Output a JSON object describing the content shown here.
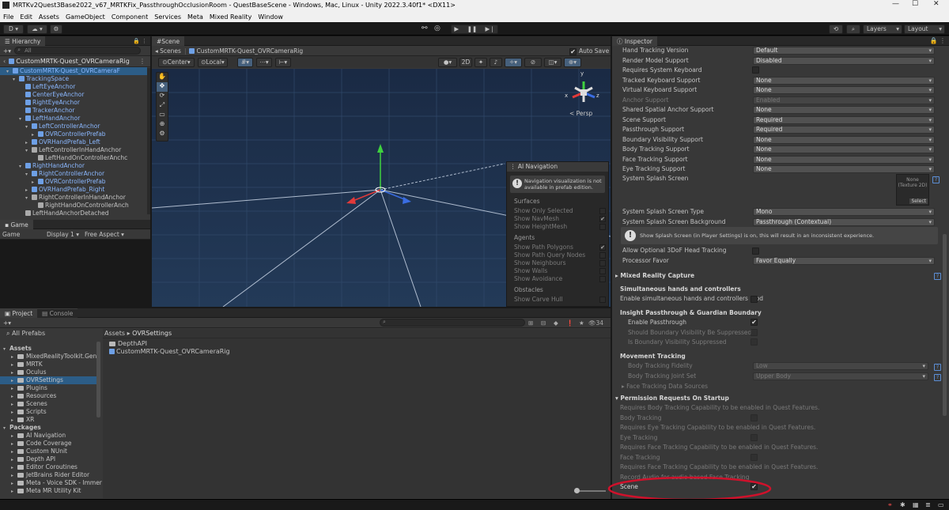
{
  "window": {
    "title": "MRTKv2Quest3Base2022_v67_MRTKFix_PassthroughOcclusionRoom - QuestBaseScene - Windows, Mac, Linux - Unity 2022.3.40f1* <DX11>",
    "minimize": "—",
    "maximize": "☐",
    "close": "✕"
  },
  "menu": [
    "File",
    "Edit",
    "Assets",
    "GameObject",
    "Component",
    "Services",
    "Meta",
    "Mixed Reality",
    "Window"
  ],
  "toolbar": {
    "account": "D",
    "layers": "Layers",
    "layout": "Layout"
  },
  "hierarchy": {
    "tab": "Hierarchy",
    "search_placeholder": "All",
    "root": "CustomMRTK-Quest_OVRCameraRig",
    "items": [
      {
        "label": "CustomMRTK-Quest_OVRCameraF",
        "indent": 1,
        "icon": "cube",
        "arrow": "▾",
        "selected": true
      },
      {
        "label": "TrackingSpace",
        "indent": 2,
        "icon": "cube",
        "arrow": "▾"
      },
      {
        "label": "LeftEyeAnchor",
        "indent": 3,
        "icon": "cube",
        "arrow": ""
      },
      {
        "label": "CenterEyeAnchor",
        "indent": 3,
        "icon": "cube",
        "arrow": ""
      },
      {
        "label": "RightEyeAnchor",
        "indent": 3,
        "icon": "cube",
        "arrow": ""
      },
      {
        "label": "TrackerAnchor",
        "indent": 3,
        "icon": "cube",
        "arrow": ""
      },
      {
        "label": "LeftHandAnchor",
        "indent": 3,
        "icon": "cube",
        "arrow": "▾"
      },
      {
        "label": "LeftControllerAnchor",
        "indent": 4,
        "icon": "cube",
        "arrow": "▾"
      },
      {
        "label": "OVRControllerPrefab",
        "indent": 5,
        "icon": "prefab",
        "arrow": "▸"
      },
      {
        "label": "OVRHandPrefab_Left",
        "indent": 4,
        "icon": "prefab",
        "arrow": "▸"
      },
      {
        "label": "LeftControllerInHandAnchor",
        "indent": 4,
        "icon": "cube",
        "arrow": "▾",
        "plain": true
      },
      {
        "label": "LeftHandOnControllerAnchc",
        "indent": 5,
        "icon": "cube",
        "arrow": "",
        "plain": true
      },
      {
        "label": "RightHandAnchor",
        "indent": 3,
        "icon": "cube",
        "arrow": "▾"
      },
      {
        "label": "RightControllerAnchor",
        "indent": 4,
        "icon": "cube",
        "arrow": "▾"
      },
      {
        "label": "OVRControllerPrefab",
        "indent": 5,
        "icon": "prefab",
        "arrow": "▸"
      },
      {
        "label": "OVRHandPrefab_Right",
        "indent": 4,
        "icon": "prefab",
        "arrow": "▸"
      },
      {
        "label": "RightControllerInHandAnchor",
        "indent": 4,
        "icon": "cube",
        "arrow": "▾",
        "plain": true
      },
      {
        "label": "RightHandOnControllerAnch",
        "indent": 5,
        "icon": "cube",
        "arrow": "",
        "plain": true
      },
      {
        "label": "LeftHandAnchorDetached",
        "indent": 3,
        "icon": "cube",
        "arrow": "",
        "plain": true
      }
    ]
  },
  "game": {
    "tab": "Game",
    "display": "Game",
    "display_num": "Display 1",
    "aspect": "Free Aspect"
  },
  "scene": {
    "tab": "Scene",
    "breadcrumb_root": "Scenes",
    "breadcrumb_item": "CustomMRTK-Quest_OVRCameraRig",
    "auto_save": "Auto Save",
    "pivot": "Center",
    "space": "Local",
    "mode_2d": "2D",
    "persp": "< Persp",
    "gizmo_x": "x",
    "gizmo_y": "y",
    "gizmo_z": "z"
  },
  "ai_nav": {
    "title": "AI Navigation",
    "notice": "Navigation visualization is not available in prefab edition.",
    "sections": [
      {
        "header": "Surfaces",
        "items": [
          {
            "label": "Show Only Selected",
            "checked": false
          },
          {
            "label": "Show NavMesh",
            "checked": true
          },
          {
            "label": "Show HeightMesh",
            "checked": false
          }
        ]
      },
      {
        "header": "Agents",
        "items": [
          {
            "label": "Show Path Polygons",
            "checked": true
          },
          {
            "label": "Show Path Query Nodes",
            "checked": false
          },
          {
            "label": "Show Neighbours",
            "checked": false
          },
          {
            "label": "Show Walls",
            "checked": false
          },
          {
            "label": "Show Avoidance",
            "checked": false
          }
        ]
      },
      {
        "header": "Obstacles",
        "items": [
          {
            "label": "Show Carve Hull",
            "checked": false
          }
        ]
      }
    ]
  },
  "project": {
    "tab_project": "Project",
    "tab_console": "Console",
    "all_prefabs": "All Prefabs",
    "hidden_count": "34",
    "breadcrumb": [
      "Assets",
      "OVRSettings"
    ],
    "tree": [
      {
        "label": "Assets",
        "indent": 0,
        "bold": true
      },
      {
        "label": "MixedRealityToolkit.Gene",
        "indent": 1
      },
      {
        "label": "MRTK",
        "indent": 1
      },
      {
        "label": "Oculus",
        "indent": 1
      },
      {
        "label": "OVRSettings",
        "indent": 1,
        "selected": true
      },
      {
        "label": "Plugins",
        "indent": 1
      },
      {
        "label": "Resources",
        "indent": 1
      },
      {
        "label": "Scenes",
        "indent": 1
      },
      {
        "label": "Scripts",
        "indent": 1
      },
      {
        "label": "XR",
        "indent": 1
      },
      {
        "label": "Packages",
        "indent": 0,
        "bold": true
      },
      {
        "label": "AI Navigation",
        "indent": 1
      },
      {
        "label": "Code Coverage",
        "indent": 1
      },
      {
        "label": "Custom NUnit",
        "indent": 1
      },
      {
        "label": "Depth API",
        "indent": 1
      },
      {
        "label": "Editor Coroutines",
        "indent": 1
      },
      {
        "label": "JetBrains Rider Editor",
        "indent": 1
      },
      {
        "label": "Meta - Voice SDK - Immer",
        "indent": 1
      },
      {
        "label": "Meta MR Utility Kit",
        "indent": 1
      }
    ],
    "files": [
      {
        "label": "DepthAPI",
        "type": "folder"
      },
      {
        "label": "CustomMRTK-Quest_OVRCameraRig",
        "type": "prefab"
      }
    ]
  },
  "inspector": {
    "tab": "Inspector",
    "rows": [
      {
        "label": "Hand Tracking Version",
        "value": "Default",
        "type": "dropdown"
      },
      {
        "label": "Render Model Support",
        "value": "Disabled",
        "type": "dropdown"
      },
      {
        "label": "Requires System Keyboard",
        "type": "checkbox",
        "checked": false
      },
      {
        "label": "Tracked Keyboard Support",
        "value": "None",
        "type": "dropdown"
      },
      {
        "label": "Virtual Keyboard Support",
        "value": "None",
        "type": "dropdown"
      },
      {
        "label": "Anchor Support",
        "value": "Enabled",
        "type": "dropdown",
        "dim": true
      },
      {
        "label": "Shared Spatial Anchor Support",
        "value": "None",
        "type": "dropdown"
      },
      {
        "label": "Scene Support",
        "value": "Required",
        "type": "dropdown"
      },
      {
        "label": "Passthrough Support",
        "value": "Required",
        "type": "dropdown"
      },
      {
        "label": "Boundary Visibility Support",
        "value": "None",
        "type": "dropdown"
      },
      {
        "label": "Body Tracking Support",
        "value": "None",
        "type": "dropdown"
      },
      {
        "label": "Face Tracking Support",
        "value": "None",
        "type": "dropdown"
      },
      {
        "label": "Eye Tracking Support",
        "value": "None",
        "type": "dropdown"
      }
    ],
    "splash_label": "System Splash Screen",
    "splash_none": "None",
    "splash_type_hint": "(Texture 2D)",
    "splash_select": "Select",
    "splash_rows": [
      {
        "label": "System Splash Screen Type",
        "value": "Mono"
      },
      {
        "label": "System Splash Screen Background",
        "value": "Passthrough (Contextual)"
      }
    ],
    "splash_warning": "Show Splash Screen (in Player Settings) is on, this will result in an inconsistent experience.",
    "allow_3dof": "Allow Optional 3DoF Head Tracking",
    "processor_favor": "Processor Favor",
    "processor_favor_value": "Favor Equally",
    "mr_capture": "Mixed Reality Capture",
    "simul_header": "Simultaneous hands and controllers",
    "simul_enable": "Enable simultaneous hands and controllers mod",
    "insight_header": "Insight Passthrough & Guardian Boundary",
    "enable_passthrough": "Enable Passthrough",
    "should_boundary": "Should Boundary Visibility Be Suppressed",
    "is_boundary": "Is Boundary Visibility Suppressed",
    "movement_header": "Movement Tracking",
    "body_fidelity": "Body Tracking Fidelity",
    "body_fidelity_value": "Low",
    "joint_set": "Body Tracking Joint Set",
    "joint_set_value": "Upper Body",
    "face_sources": "Face Tracking Data Sources",
    "permission_header": "Permission Requests On Startup",
    "perm_body_note": "Requires Body Tracking Capability to be enabled in Quest Features.",
    "perm_body": "Body Tracking",
    "perm_eye_note": "Requires Eye Tracking Capability to be enabled in Quest Features.",
    "perm_eye": "Eye Tracking",
    "perm_face_note": "Requires Face Tracking Capability to be enabled in Quest Features.",
    "perm_face": "Face Tracking",
    "perm_face2_note": "Requires Face Tracking Capability to be enabled in Quest Features.",
    "perm_audio": "Record Audio for audio based Face Tracking",
    "perm_scene": "Scene"
  },
  "colors": {
    "highlight_ellipse": "#d0112b",
    "prefab_blue": "#8bb8ff",
    "selection": "#2c5d87"
  }
}
